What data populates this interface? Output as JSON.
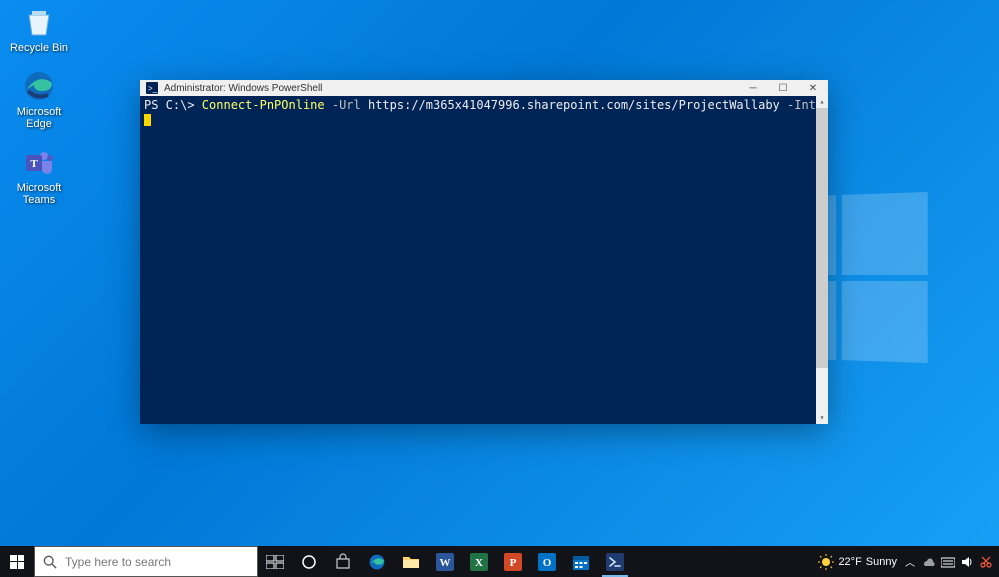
{
  "desktop": {
    "icons": [
      {
        "label": "Recycle Bin"
      },
      {
        "label": "Microsoft\nEdge"
      },
      {
        "label": "Microsoft\nTeams"
      }
    ]
  },
  "window": {
    "title": "Administrator: Windows PowerShell"
  },
  "console": {
    "prompt": "PS C:\\> ",
    "command": "Connect-PnPOnline",
    "param1": " -Url",
    "url": " https://m365x41047996.sharepoint.com/sites/ProjectWallaby",
    "param2": " -Interactive"
  },
  "taskbar": {
    "search_placeholder": "Type here to search"
  },
  "tray": {
    "weather_temp": "22°F",
    "weather_cond": "Sunny"
  }
}
